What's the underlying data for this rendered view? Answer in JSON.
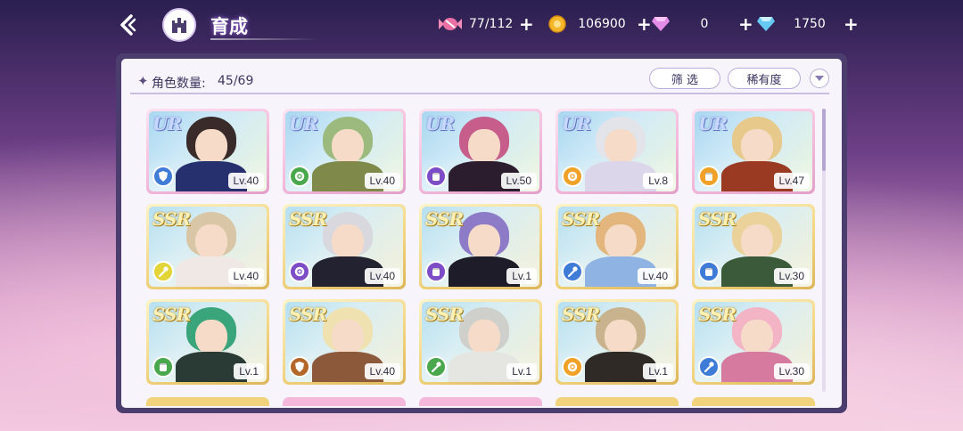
{
  "header": {
    "title": "育成",
    "back_icon": "back-arrow-icon",
    "home_icon": "castle-icon"
  },
  "resources": [
    {
      "name": "candy",
      "icon": "candy-icon",
      "value": "77/112",
      "color": "#e96fa4"
    },
    {
      "name": "gold",
      "icon": "gold-coin-icon",
      "value": "106900",
      "color": "#f4b728"
    },
    {
      "name": "pink-gem",
      "icon": "pink-diamond-icon",
      "value": "0",
      "color": "#e58be8"
    },
    {
      "name": "blue-gem",
      "icon": "blue-diamond-icon",
      "value": "1750",
      "color": "#66c9f2"
    }
  ],
  "panel": {
    "count_label": "角色数量:",
    "count_value": "45/69",
    "filter_label": "筛 选",
    "rarity_sort_label": "稀有度",
    "sort_toggle_icon": "chevron-down-icon"
  },
  "cards": [
    {
      "rarity": "UR",
      "level": "Lv.40",
      "attr_color": "#3f7cd8",
      "attr_icon": "shield-icon",
      "hair": "#3a2b2b",
      "outfit": "#27306e"
    },
    {
      "rarity": "UR",
      "level": "Lv.40",
      "attr_color": "#4aa84c",
      "attr_icon": "gear-icon",
      "hair": "#9cba7d",
      "outfit": "#7f8a4a"
    },
    {
      "rarity": "UR",
      "level": "Lv.50",
      "attr_color": "#7d4cc7",
      "attr_icon": "fist-icon",
      "hair": "#c65d8a",
      "outfit": "#2b1d2e"
    },
    {
      "rarity": "UR",
      "level": "Lv.8",
      "attr_color": "#f0a228",
      "attr_icon": "gear-icon",
      "hair": "#e2e4ea",
      "outfit": "#dcd6ea"
    },
    {
      "rarity": "UR",
      "level": "Lv.47",
      "attr_color": "#f0a228",
      "attr_icon": "fist-icon",
      "hair": "#e8c98c",
      "outfit": "#9b3a22"
    },
    {
      "rarity": "SSR",
      "level": "Lv.40",
      "attr_color": "#e3d437",
      "attr_icon": "wand-icon",
      "hair": "#d9c6a6",
      "outfit": "#efe8e4"
    },
    {
      "rarity": "SSR",
      "level": "Lv.40",
      "attr_color": "#7d4cc7",
      "attr_icon": "gear-icon",
      "hair": "#d8d8de",
      "outfit": "#222230"
    },
    {
      "rarity": "SSR",
      "level": "Lv.1",
      "attr_color": "#7d4cc7",
      "attr_icon": "fist-icon",
      "hair": "#8e7bc7",
      "outfit": "#1d1c28"
    },
    {
      "rarity": "SSR",
      "level": "Lv.40",
      "attr_color": "#3f7cd8",
      "attr_icon": "wand-icon",
      "hair": "#e2b67c",
      "outfit": "#8fb3e2"
    },
    {
      "rarity": "SSR",
      "level": "Lv.30",
      "attr_color": "#3f7cd8",
      "attr_icon": "fist-icon",
      "hair": "#ead29a",
      "outfit": "#3b5a3a"
    },
    {
      "rarity": "SSR",
      "level": "Lv.1",
      "attr_color": "#4aa84c",
      "attr_icon": "fist-icon",
      "hair": "#3aa57a",
      "outfit": "#2a3b36"
    },
    {
      "rarity": "SSR",
      "level": "Lv.40",
      "attr_color": "#b5672a",
      "attr_icon": "shield-icon",
      "hair": "#efe1b0",
      "outfit": "#8c5a3b"
    },
    {
      "rarity": "SSR",
      "level": "Lv.1",
      "attr_color": "#4aa84c",
      "attr_icon": "wand-icon",
      "hair": "#cfd0cc",
      "outfit": "#e5e6e2"
    },
    {
      "rarity": "SSR",
      "level": "Lv.1",
      "attr_color": "#f0a228",
      "attr_icon": "gear-icon",
      "hair": "#c9b38e",
      "outfit": "#2f2a25"
    },
    {
      "rarity": "SSR",
      "level": "Lv.30",
      "attr_color": "#3f7cd8",
      "attr_icon": "wand-icon",
      "hair": "#f3b4c6",
      "outfit": "#d67aa0"
    }
  ],
  "partial_row_colors": [
    "#f1d37d",
    "#f3b8da",
    "#f3b8da",
    "#f1d37d",
    "#f1d37d"
  ]
}
